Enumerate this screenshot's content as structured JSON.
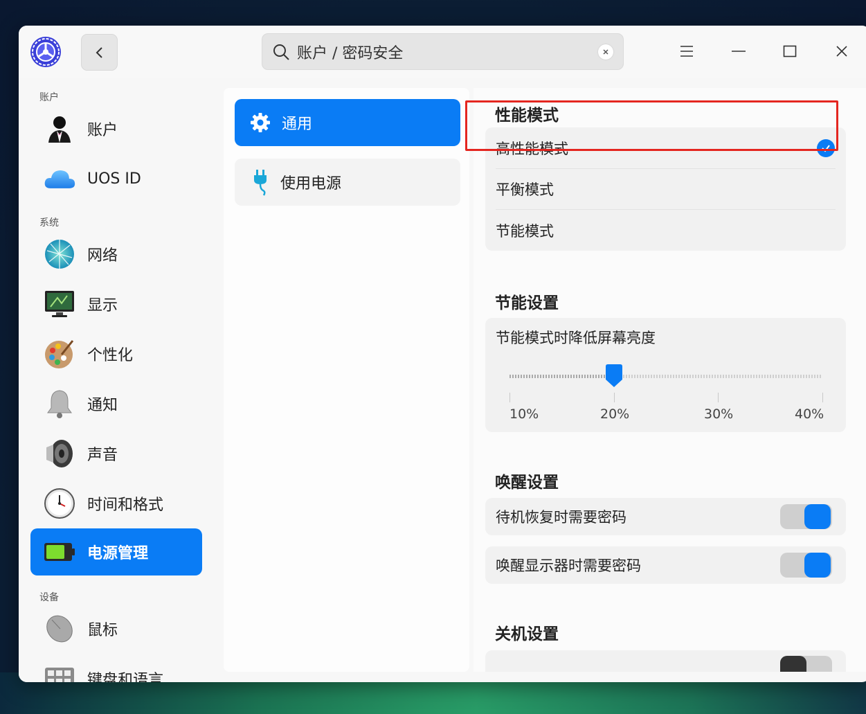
{
  "search": {
    "text": "账户 / 密码安全"
  },
  "sidebar": {
    "sections": {
      "account": "账户",
      "system": "系统",
      "device": "设备"
    },
    "items": [
      {
        "label": "账户",
        "icon": "user-icon"
      },
      {
        "label": "UOS ID",
        "icon": "cloud-icon"
      },
      {
        "label": "网络",
        "icon": "network-icon"
      },
      {
        "label": "显示",
        "icon": "display-icon"
      },
      {
        "label": "个性化",
        "icon": "palette-icon"
      },
      {
        "label": "通知",
        "icon": "bell-icon"
      },
      {
        "label": "声音",
        "icon": "speaker-icon"
      },
      {
        "label": "时间和格式",
        "icon": "clock-icon"
      },
      {
        "label": "电源管理",
        "icon": "battery-icon",
        "active": true
      },
      {
        "label": "鼠标",
        "icon": "mouse-icon"
      },
      {
        "label": "键盘和语言",
        "icon": "keyboard-icon"
      }
    ]
  },
  "middle": {
    "items": [
      {
        "label": "通用",
        "icon": "gear-icon",
        "active": true
      },
      {
        "label": "使用电源",
        "icon": "plug-icon"
      }
    ]
  },
  "content": {
    "performance": {
      "title": "性能模式",
      "options": [
        "高性能模式",
        "平衡模式",
        "节能模式"
      ],
      "selected": "高性能模式"
    },
    "power_saving": {
      "title": "节能设置",
      "brightness_label": "节能模式时降低屏幕亮度",
      "slider_ticks": [
        "10%",
        "20%",
        "30%",
        "40%"
      ],
      "slider_value": "20%"
    },
    "wakeup": {
      "title": "唤醒设置",
      "items": [
        {
          "label": "待机恢复时需要密码",
          "on": true
        },
        {
          "label": "唤醒显示器时需要密码",
          "on": true
        }
      ]
    },
    "shutdown": {
      "title": "关机设置"
    }
  },
  "colors": {
    "accent": "#0a7cf5",
    "highlight": "#e42620"
  }
}
